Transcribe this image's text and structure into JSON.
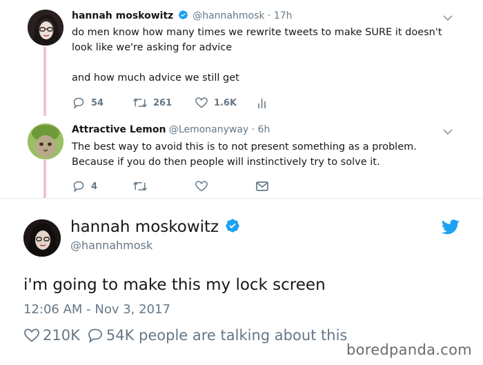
{
  "tweet1": {
    "name": "hannah moskowitz",
    "handle_time": "@hannahmosk · 17h",
    "text_a": "do men know how many times we rewrite tweets to make SURE it doesn't look like we're asking for advice",
    "text_b": "and how much advice we still get",
    "replies": "54",
    "retweets": "261",
    "likes": "1.6K"
  },
  "tweet2": {
    "name": "Attractive Lemon",
    "handle_time": "@Lemonanyway · 6h",
    "text": "The best way to avoid this is to not present something as a problem. Because if you do then people will instinctively try to solve it.",
    "replies": "4"
  },
  "big_tweet": {
    "name": "hannah moskowitz",
    "handle": "@hannahmosk",
    "text": "i'm going to make this my lock screen",
    "timestamp": "12:06 AM - Nov 3, 2017",
    "likes": "210K",
    "replies_text": "54K people are talking about this"
  },
  "watermark": "boredpanda.com",
  "colors": {
    "verified": "#1da1f2",
    "twitter_blue": "#1da1f2",
    "thread_line": "#f2c3cf",
    "secondary_text": "#657786"
  },
  "icons": [
    "verified-icon",
    "chevron-down-icon",
    "reply-icon",
    "retweet-icon",
    "like-icon",
    "analytics-icon",
    "message-icon",
    "twitter-bird-icon"
  ]
}
